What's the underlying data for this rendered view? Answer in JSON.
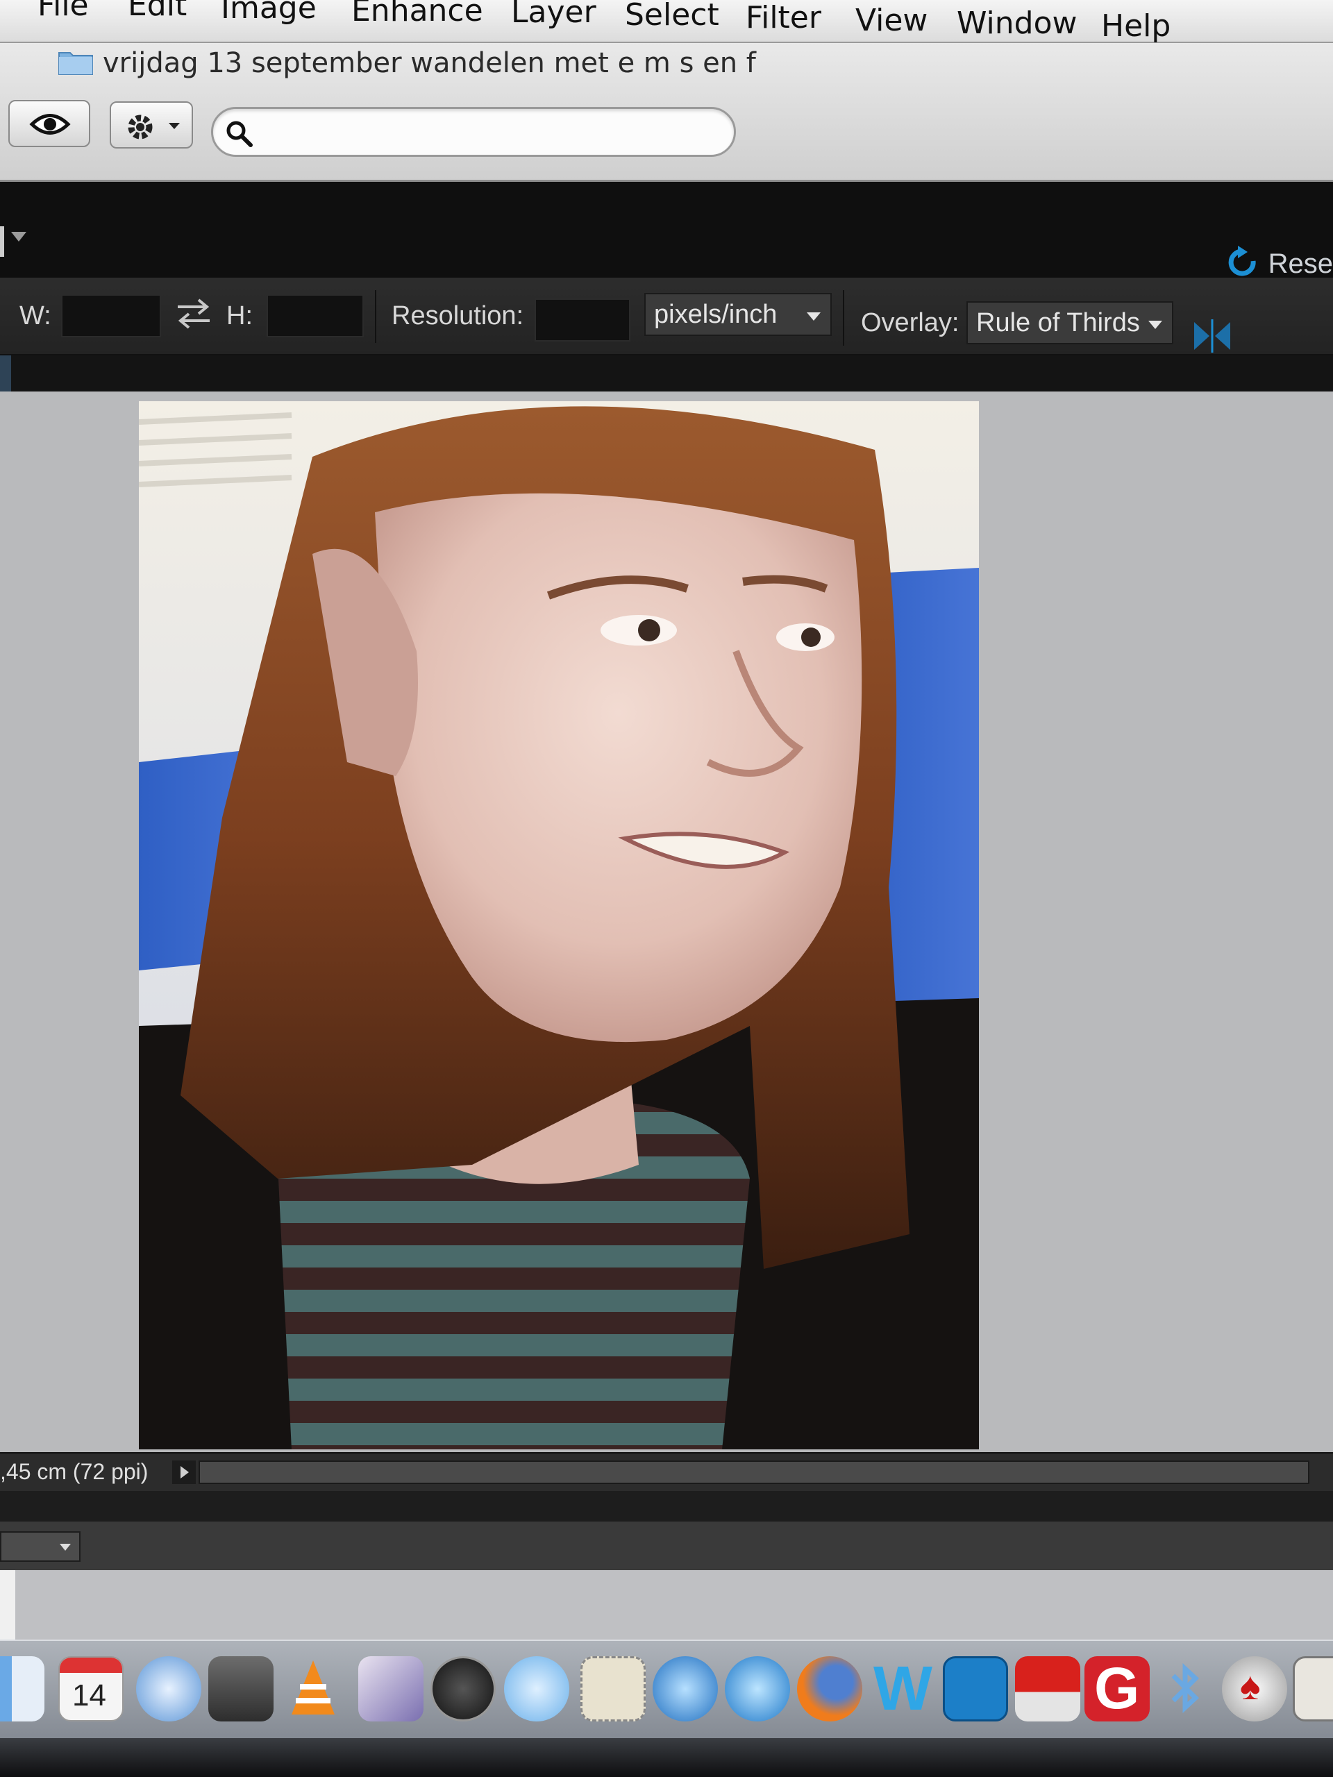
{
  "menubar": {
    "items": [
      "File",
      "Edit",
      "Image",
      "Enhance",
      "Layer",
      "Select",
      "Filter",
      "View",
      "Window",
      "Help"
    ]
  },
  "browser": {
    "folder_title": "vrijdag 13 september wandelen met e m s en f",
    "search": {
      "value": "",
      "placeholder": ""
    }
  },
  "editor": {
    "reset_label": "Rese"
  },
  "options": {
    "width_label": "W:",
    "height_label": "H:",
    "resolution_label": "Resolution:",
    "resolution_unit": "pixels/inch",
    "overlay_label": "Overlay:",
    "overlay_value": "Rule of Thirds"
  },
  "status": {
    "doc_size": ",45 cm (72 ppi)"
  },
  "dock": {
    "icons": [
      "finder-icon",
      "calendar-icon",
      "safari-icon",
      "preview-icon",
      "vlc-icon",
      "pen-app-icon",
      "dashboard-icon",
      "ichat-icon",
      "mail-stamp-icon",
      "google-earth-icon",
      "itunes-icon",
      "firefox-icon",
      "word-icon",
      "iphoto-icon",
      "photo-booth-icon",
      "google-icon",
      "bluetooth-icon",
      "solitaire-icon",
      "photos-icon"
    ],
    "calendar_day": "14",
    "word_letter": "W",
    "google_letter": "G"
  },
  "colors": {
    "accent_blue": "#1c8fd4",
    "dark_panel": "#232323",
    "canvas_gray": "#b9babc"
  }
}
